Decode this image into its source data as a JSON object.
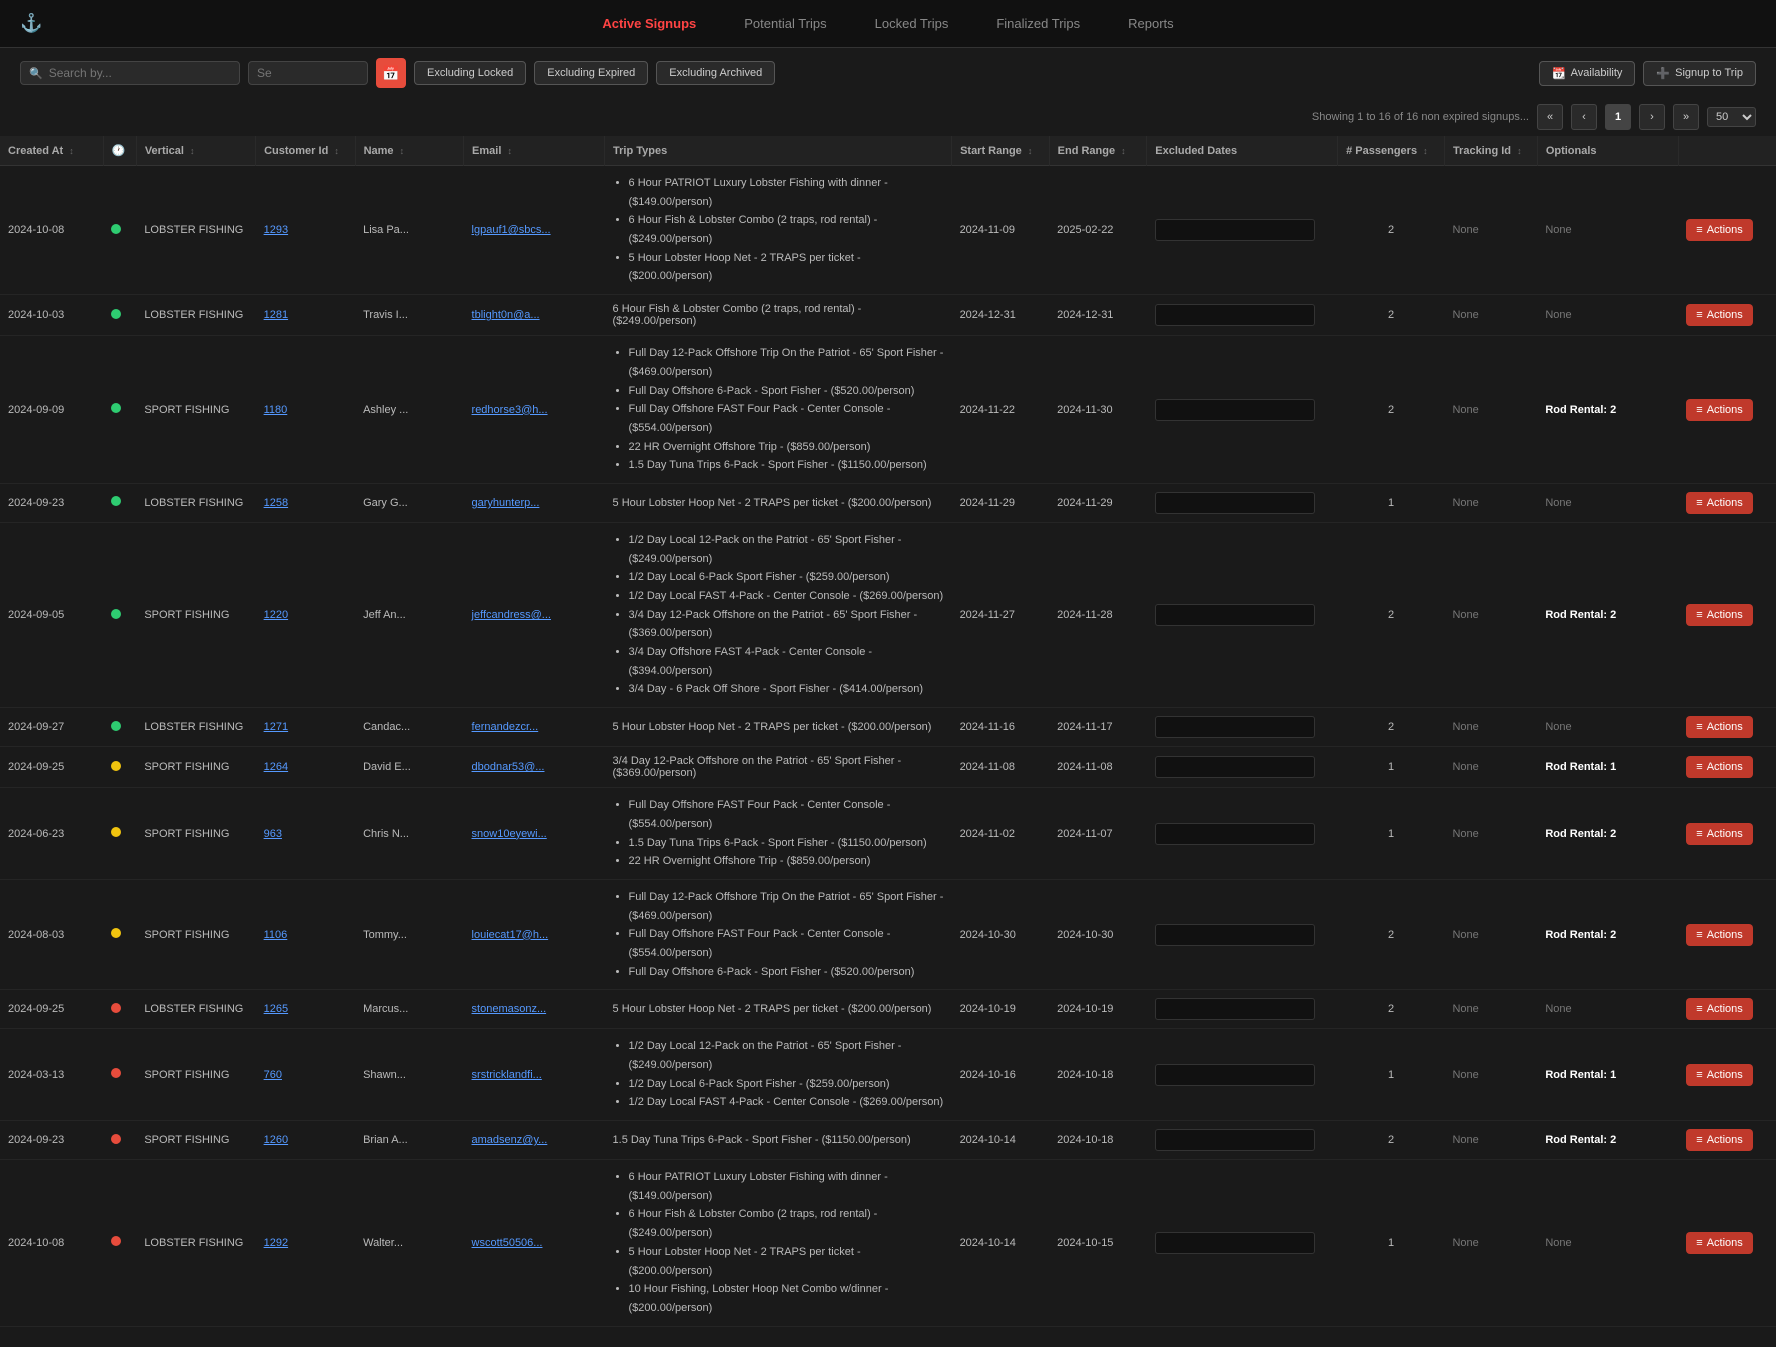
{
  "nav": {
    "items": [
      {
        "label": "Active Signups",
        "active": true
      },
      {
        "label": "Potential Trips",
        "active": false
      },
      {
        "label": "Locked Trips",
        "active": false
      },
      {
        "label": "Finalized Trips",
        "active": false
      },
      {
        "label": "Reports",
        "active": false
      }
    ]
  },
  "toolbar": {
    "search_placeholder": "Search by...",
    "search2_placeholder": "Se",
    "filter_excluding_locked": "Excluding Locked",
    "filter_excluding_expired": "Excluding Expired",
    "filter_excluding_archived": "Excluding Archived",
    "btn_availability": "Availability",
    "btn_signup_to_trip": "Signup to Trip"
  },
  "pagination": {
    "showing_text": "Showing 1 to 16 of 16 non expired signups...",
    "current_page": "1",
    "page_size": "50"
  },
  "table": {
    "headers": [
      {
        "label": "Created At",
        "sortable": true
      },
      {
        "label": "",
        "sortable": false
      },
      {
        "label": "Vertical",
        "sortable": true
      },
      {
        "label": "Customer Id",
        "sortable": true
      },
      {
        "label": "Name",
        "sortable": true
      },
      {
        "label": "Email",
        "sortable": true
      },
      {
        "label": "Trip Types",
        "sortable": false
      },
      {
        "label": "Start Range",
        "sortable": true
      },
      {
        "label": "End Range",
        "sortable": true
      },
      {
        "label": "Excluded Dates",
        "sortable": false
      },
      {
        "label": "# Passengers",
        "sortable": true
      },
      {
        "label": "Tracking Id",
        "sortable": true
      },
      {
        "label": "Optionals",
        "sortable": false
      },
      {
        "label": "",
        "sortable": false
      }
    ],
    "rows": [
      {
        "created": "2024-10-08",
        "dot": "green",
        "vertical": "LOBSTER FISHING",
        "customer_id": "1293",
        "name": "Lisa Pa...",
        "email": "lgpauf1@sbcs...",
        "trips": [
          "6 Hour PATRIOT Luxury Lobster Fishing with dinner - ($149.00/person)",
          "6 Hour Fish & Lobster Combo (2 traps, rod rental) - ($249.00/person)",
          "5 Hour Lobster Hoop Net - 2 TRAPS per ticket - ($200.00/person)"
        ],
        "start_range": "2024-11-09",
        "end_range": "2025-02-22",
        "passengers": "2",
        "tracking": "None",
        "optionals": "None"
      },
      {
        "created": "2024-10-03",
        "dot": "green",
        "vertical": "LOBSTER FISHING",
        "customer_id": "1281",
        "name": "Travis I...",
        "email": "tblight0n@a...",
        "trips": [
          "6 Hour Fish & Lobster Combo (2 traps, rod rental) - ($249.00/person)"
        ],
        "start_range": "2024-12-31",
        "end_range": "2024-12-31",
        "passengers": "2",
        "tracking": "None",
        "optionals": "None"
      },
      {
        "created": "2024-09-09",
        "dot": "green",
        "vertical": "SPORT FISHING",
        "customer_id": "1180",
        "name": "Ashley ...",
        "email": "redhorse3@h...",
        "trips": [
          "Full Day 12-Pack Offshore Trip On the Patriot - 65' Sport Fisher - ($469.00/person)",
          "Full Day Offshore 6-Pack - Sport Fisher - ($520.00/person)",
          "Full Day Offshore FAST Four Pack - Center Console - ($554.00/person)",
          "22 HR Overnight Offshore Trip - ($859.00/person)",
          "1.5 Day Tuna Trips 6-Pack - Sport Fisher - ($1150.00/person)"
        ],
        "start_range": "2024-11-22",
        "end_range": "2024-11-30",
        "passengers": "2",
        "tracking": "None",
        "optionals": "Rod Rental: 2"
      },
      {
        "created": "2024-09-23",
        "dot": "green",
        "vertical": "LOBSTER FISHING",
        "customer_id": "1258",
        "name": "Gary G...",
        "email": "garyhunterp...",
        "trips": [
          "5 Hour Lobster Hoop Net - 2 TRAPS per ticket - ($200.00/person)"
        ],
        "start_range": "2024-11-29",
        "end_range": "2024-11-29",
        "passengers": "1",
        "tracking": "None",
        "optionals": "None"
      },
      {
        "created": "2024-09-05",
        "dot": "green",
        "vertical": "SPORT FISHING",
        "customer_id": "1220",
        "name": "Jeff An...",
        "email": "jeffcandress@...",
        "trips": [
          "1/2 Day Local 12-Pack on the Patriot - 65' Sport Fisher - ($249.00/person)",
          "1/2 Day Local 6-Pack Sport Fisher - ($259.00/person)",
          "1/2 Day Local FAST 4-Pack - Center Console - ($269.00/person)",
          "3/4 Day 12-Pack Offshore on the Patriot - 65' Sport Fisher - ($369.00/person)",
          "3/4 Day Offshore FAST 4-Pack - Center Console - ($394.00/person)",
          "3/4 Day - 6 Pack Off Shore - Sport Fisher - ($414.00/person)"
        ],
        "start_range": "2024-11-27",
        "end_range": "2024-11-28",
        "passengers": "2",
        "tracking": "None",
        "optionals": "Rod Rental: 2"
      },
      {
        "created": "2024-09-27",
        "dot": "green",
        "vertical": "LOBSTER FISHING",
        "customer_id": "1271",
        "name": "Candac...",
        "email": "fernandezcr...",
        "trips": [
          "5 Hour Lobster Hoop Net - 2 TRAPS per ticket - ($200.00/person)"
        ],
        "start_range": "2024-11-16",
        "end_range": "2024-11-17",
        "passengers": "2",
        "tracking": "None",
        "optionals": "None"
      },
      {
        "created": "2024-09-25",
        "dot": "yellow",
        "vertical": "SPORT FISHING",
        "customer_id": "1264",
        "name": "David E...",
        "email": "dbodnar53@...",
        "trips": [
          "3/4 Day 12-Pack Offshore on the Patriot - 65' Sport Fisher - ($369.00/person)"
        ],
        "start_range": "2024-11-08",
        "end_range": "2024-11-08",
        "passengers": "1",
        "tracking": "None",
        "optionals": "Rod Rental: 1"
      },
      {
        "created": "2024-06-23",
        "dot": "yellow",
        "vertical": "SPORT FISHING",
        "customer_id": "963",
        "name": "Chris N...",
        "email": "snow10eyewi...",
        "trips": [
          "Full Day Offshore FAST Four Pack - Center Console - ($554.00/person)",
          "1.5 Day Tuna Trips 6-Pack - Sport Fisher - ($1150.00/person)",
          "22 HR Overnight Offshore Trip - ($859.00/person)"
        ],
        "start_range": "2024-11-02",
        "end_range": "2024-11-07",
        "passengers": "1",
        "tracking": "None",
        "optionals": "Rod Rental: 2"
      },
      {
        "created": "2024-08-03",
        "dot": "yellow",
        "vertical": "SPORT FISHING",
        "customer_id": "1106",
        "name": "Tommy...",
        "email": "louiecat17@h...",
        "trips": [
          "Full Day 12-Pack Offshore Trip On the Patriot - 65' Sport Fisher - ($469.00/person)",
          "Full Day Offshore FAST Four Pack - Center Console - ($554.00/person)",
          "Full Day Offshore 6-Pack - Sport Fisher - ($520.00/person)"
        ],
        "start_range": "2024-10-30",
        "end_range": "2024-10-30",
        "passengers": "2",
        "tracking": "None",
        "optionals": "Rod Rental: 2"
      },
      {
        "created": "2024-09-25",
        "dot": "red",
        "vertical": "LOBSTER FISHING",
        "customer_id": "1265",
        "name": "Marcus...",
        "email": "stonemasonz...",
        "trips": [
          "5 Hour Lobster Hoop Net - 2 TRAPS per ticket - ($200.00/person)"
        ],
        "start_range": "2024-10-19",
        "end_range": "2024-10-19",
        "passengers": "2",
        "tracking": "None",
        "optionals": "None"
      },
      {
        "created": "2024-03-13",
        "dot": "red",
        "vertical": "SPORT FISHING",
        "customer_id": "760",
        "name": "Shawn...",
        "email": "srstricklandfi...",
        "trips": [
          "1/2 Day Local 12-Pack on the Patriot - 65' Sport Fisher - ($249.00/person)",
          "1/2 Day Local 6-Pack Sport Fisher - ($259.00/person)",
          "1/2 Day Local FAST 4-Pack - Center Console - ($269.00/person)"
        ],
        "start_range": "2024-10-16",
        "end_range": "2024-10-18",
        "passengers": "1",
        "tracking": "None",
        "optionals": "Rod Rental: 1"
      },
      {
        "created": "2024-09-23",
        "dot": "red",
        "vertical": "SPORT FISHING",
        "customer_id": "1260",
        "name": "Brian A...",
        "email": "amadsenz@y...",
        "trips": [
          "1.5 Day Tuna Trips 6-Pack - Sport Fisher - ($1150.00/person)"
        ],
        "start_range": "2024-10-14",
        "end_range": "2024-10-18",
        "passengers": "2",
        "tracking": "None",
        "optionals": "Rod Rental: 2"
      },
      {
        "created": "2024-10-08",
        "dot": "red",
        "vertical": "LOBSTER FISHING",
        "customer_id": "1292",
        "name": "Walter...",
        "email": "wscott50506...",
        "trips": [
          "6 Hour PATRIOT Luxury Lobster Fishing with dinner - ($149.00/person)",
          "6 Hour Fish & Lobster Combo (2 traps, rod rental) - ($249.00/person)",
          "5 Hour Lobster Hoop Net - 2 TRAPS per ticket - ($200.00/person)",
          "10 Hour Fishing, Lobster Hoop Net Combo w/dinner - ($200.00/person)"
        ],
        "start_range": "2024-10-14",
        "end_range": "2024-10-15",
        "passengers": "1",
        "tracking": "None",
        "optionals": "None"
      }
    ]
  }
}
